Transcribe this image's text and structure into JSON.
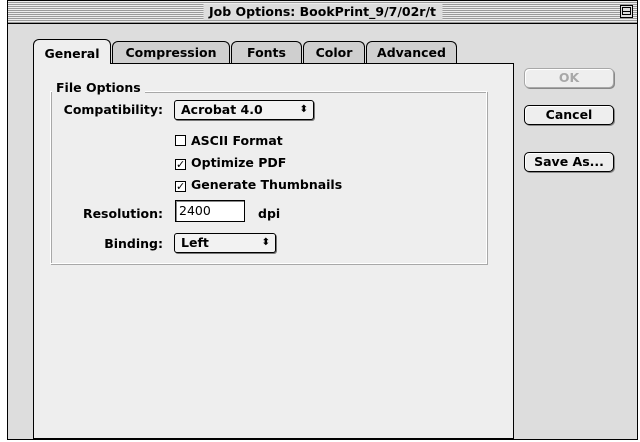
{
  "window": {
    "title": "Job Options: BookPrint_9/7/02r/t"
  },
  "tabs": [
    {
      "label": "General",
      "active": true
    },
    {
      "label": "Compression",
      "active": false
    },
    {
      "label": "Fonts",
      "active": false
    },
    {
      "label": "Color",
      "active": false
    },
    {
      "label": "Advanced",
      "active": false
    }
  ],
  "file_options": {
    "group_title": "File Options",
    "compatibility_label": "Compatibility:",
    "compatibility_value": "Acrobat 4.0",
    "ascii_format": {
      "label": "ASCII Format",
      "checked": false
    },
    "optimize_pdf": {
      "label": "Optimize PDF",
      "checked": true
    },
    "generate_thumbnails": {
      "label": "Generate Thumbnails",
      "checked": true
    },
    "resolution_label": "Resolution:",
    "resolution_value": "2400",
    "resolution_unit": "dpi",
    "binding_label": "Binding:",
    "binding_value": "Left"
  },
  "buttons": {
    "ok": "OK",
    "cancel": "Cancel",
    "save_as": "Save As..."
  },
  "glyphs": {
    "popup_arrows": "⬍",
    "check": "✓"
  }
}
